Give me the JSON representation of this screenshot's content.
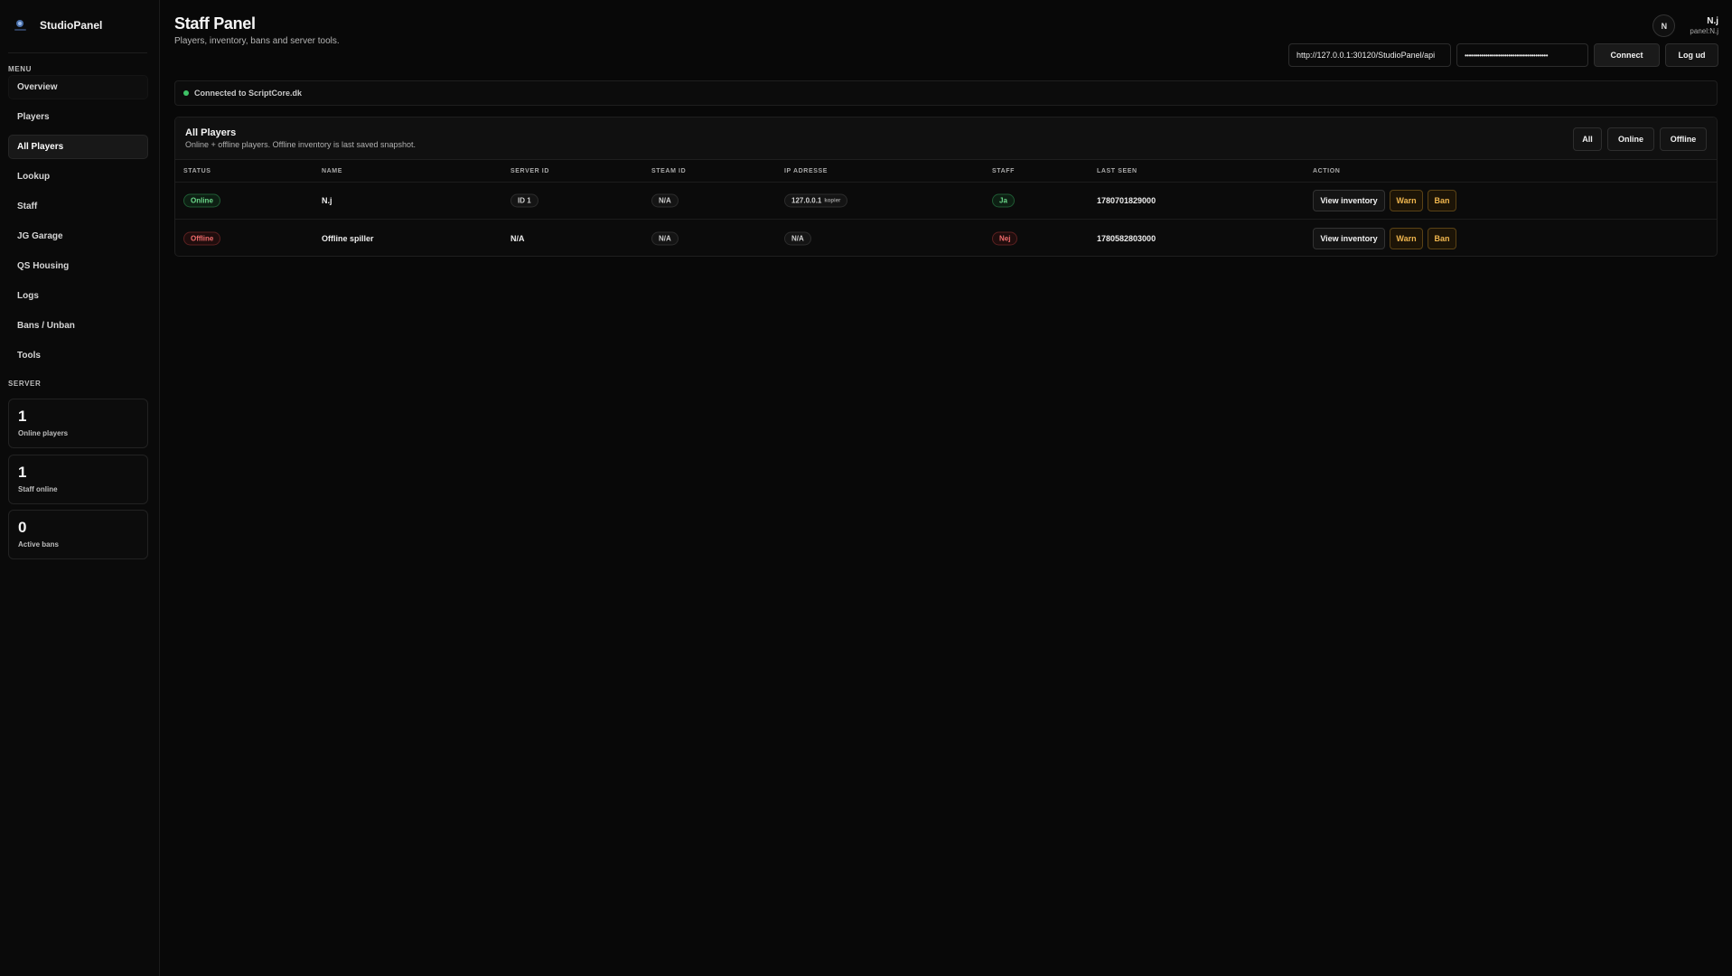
{
  "brand": {
    "name": "StudioPanel"
  },
  "sidebar": {
    "menu_label": "MENU",
    "items": [
      {
        "label": "Overview"
      },
      {
        "label": "Players"
      },
      {
        "label": "All Players"
      },
      {
        "label": "Lookup"
      },
      {
        "label": "Staff"
      },
      {
        "label": "JG Garage"
      },
      {
        "label": "QS Housing"
      },
      {
        "label": "Logs"
      },
      {
        "label": "Bans / Unban"
      },
      {
        "label": "Tools"
      }
    ],
    "active_item": "All Players",
    "server_label": "SERVER",
    "stats": [
      {
        "value": "1",
        "label": "Online players"
      },
      {
        "value": "1",
        "label": "Staff online"
      },
      {
        "value": "0",
        "label": "Active bans"
      }
    ]
  },
  "header": {
    "title": "Staff Panel",
    "subtitle": "Players, inventory, bans and server tools."
  },
  "user": {
    "initial": "N",
    "name": "N.j",
    "handle": "panel:N.j"
  },
  "connection": {
    "url_value": "http://127.0.0.1:30120/StudioPanel/api",
    "password_mask": "••••••••••••••••••••••••••••••••••••••••",
    "connect_label": "Connect",
    "logout_label": "Log ud"
  },
  "status": {
    "text": "Connected to ScriptCore.dk",
    "color": "#3ec266"
  },
  "players_panel": {
    "title": "All Players",
    "subtitle": "Online + offline players. Offline inventory is last saved snapshot.",
    "filters": [
      "All",
      "Online",
      "Offline"
    ],
    "columns": [
      "STATUS",
      "NAME",
      "SERVER ID",
      "STEAM ID",
      "IP ADRESSE",
      "STAFF",
      "LAST SEEN",
      "ACTION"
    ],
    "rows": [
      {
        "status": "Online",
        "name": "N.j",
        "server_id": "ID 1",
        "steam_id": "N/A",
        "ip": "127.0.0.1",
        "ip_copy": "kopier",
        "staff": "Ja",
        "last_seen": "1780701829000",
        "actions": [
          "View inventory",
          "Warn",
          "Ban"
        ]
      },
      {
        "status": "Offline",
        "name": "Offline spiller",
        "server_id": "N/A",
        "steam_id": "N/A",
        "ip": "N/A",
        "staff": "Nej",
        "last_seen": "1780582803000",
        "actions": [
          "View inventory",
          "Warn",
          "Ban"
        ]
      }
    ]
  },
  "colors": {
    "online": "#6bd98a",
    "offline": "#f06b6b",
    "warn": "#f0b64e"
  }
}
